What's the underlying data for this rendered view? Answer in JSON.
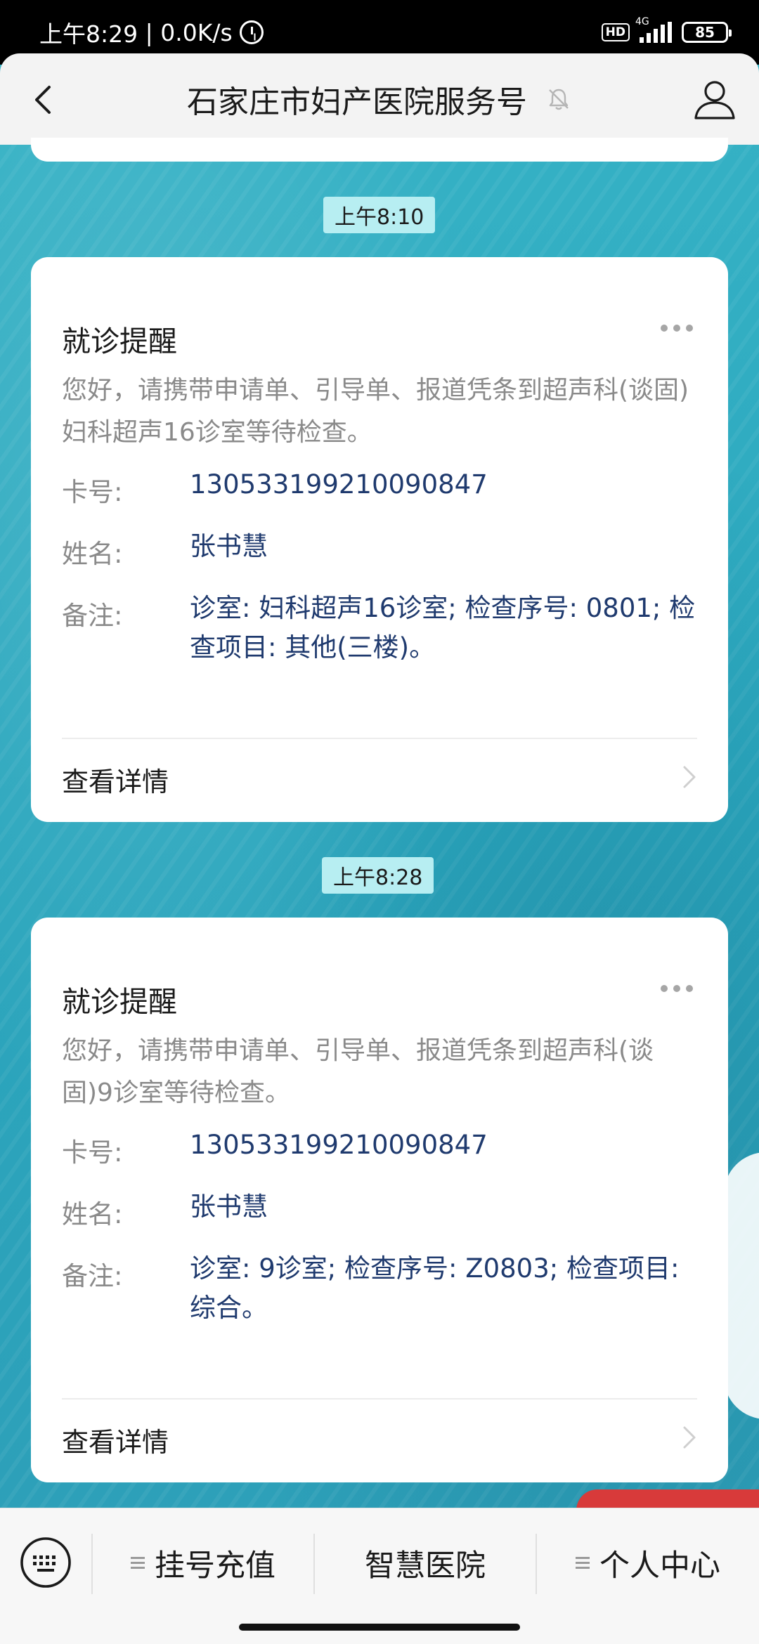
{
  "status_bar": {
    "time": "上午8:29",
    "speed": "0.0K/s",
    "hd": "HD",
    "network": "4G",
    "battery": "85"
  },
  "header": {
    "title": "石家庄市妇产医院服务号"
  },
  "messages": [
    {
      "time": "上午8:10",
      "title": "就诊提醒",
      "desc": "您好，请携带申请单、引导单、报道凭条到超声科(谈固)妇科超声16诊室等待检查。",
      "card_label": "卡号:",
      "card_value": "130533199210090847",
      "name_label": "姓名:",
      "name_value": "张书慧",
      "note_label": "备注:",
      "note_value": "诊室: 妇科超声16诊室; 检查序号: 0801; 检查项目: 其他(三楼)。",
      "detail_label": "查看详情"
    },
    {
      "time": "上午8:28",
      "title": "就诊提醒",
      "desc": "您好，请携带申请单、引导单、报道凭条到超声科(谈固)9诊室等待检查。",
      "card_label": "卡号:",
      "card_value": "130533199210090847",
      "name_label": "姓名:",
      "name_value": "张书慧",
      "note_label": "备注:",
      "note_value": "诊室: 9诊室; 检查序号: Z0803; 检查项目: 综合。",
      "detail_label": "查看详情"
    }
  ],
  "menu": {
    "item1": "挂号充值",
    "item2": "智慧医院",
    "item3": "个人中心"
  },
  "colors": {
    "background": "#2aa9bf",
    "time_pill": "#b7eef2",
    "value_text": "#1f3a6e",
    "muted_text": "#8a8a8a"
  }
}
